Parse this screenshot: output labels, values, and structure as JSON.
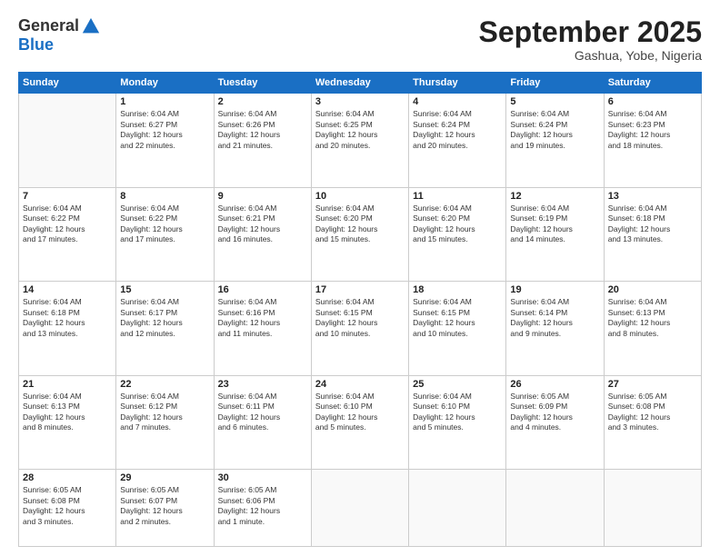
{
  "header": {
    "logo_general": "General",
    "logo_blue": "Blue",
    "month": "September 2025",
    "location": "Gashua, Yobe, Nigeria"
  },
  "days_of_week": [
    "Sunday",
    "Monday",
    "Tuesday",
    "Wednesday",
    "Thursday",
    "Friday",
    "Saturday"
  ],
  "weeks": [
    [
      {
        "day": "",
        "info": ""
      },
      {
        "day": "1",
        "info": "Sunrise: 6:04 AM\nSunset: 6:27 PM\nDaylight: 12 hours\nand 22 minutes."
      },
      {
        "day": "2",
        "info": "Sunrise: 6:04 AM\nSunset: 6:26 PM\nDaylight: 12 hours\nand 21 minutes."
      },
      {
        "day": "3",
        "info": "Sunrise: 6:04 AM\nSunset: 6:25 PM\nDaylight: 12 hours\nand 20 minutes."
      },
      {
        "day": "4",
        "info": "Sunrise: 6:04 AM\nSunset: 6:24 PM\nDaylight: 12 hours\nand 20 minutes."
      },
      {
        "day": "5",
        "info": "Sunrise: 6:04 AM\nSunset: 6:24 PM\nDaylight: 12 hours\nand 19 minutes."
      },
      {
        "day": "6",
        "info": "Sunrise: 6:04 AM\nSunset: 6:23 PM\nDaylight: 12 hours\nand 18 minutes."
      }
    ],
    [
      {
        "day": "7",
        "info": "Sunrise: 6:04 AM\nSunset: 6:22 PM\nDaylight: 12 hours\nand 17 minutes."
      },
      {
        "day": "8",
        "info": "Sunrise: 6:04 AM\nSunset: 6:22 PM\nDaylight: 12 hours\nand 17 minutes."
      },
      {
        "day": "9",
        "info": "Sunrise: 6:04 AM\nSunset: 6:21 PM\nDaylight: 12 hours\nand 16 minutes."
      },
      {
        "day": "10",
        "info": "Sunrise: 6:04 AM\nSunset: 6:20 PM\nDaylight: 12 hours\nand 15 minutes."
      },
      {
        "day": "11",
        "info": "Sunrise: 6:04 AM\nSunset: 6:20 PM\nDaylight: 12 hours\nand 15 minutes."
      },
      {
        "day": "12",
        "info": "Sunrise: 6:04 AM\nSunset: 6:19 PM\nDaylight: 12 hours\nand 14 minutes."
      },
      {
        "day": "13",
        "info": "Sunrise: 6:04 AM\nSunset: 6:18 PM\nDaylight: 12 hours\nand 13 minutes."
      }
    ],
    [
      {
        "day": "14",
        "info": "Sunrise: 6:04 AM\nSunset: 6:18 PM\nDaylight: 12 hours\nand 13 minutes."
      },
      {
        "day": "15",
        "info": "Sunrise: 6:04 AM\nSunset: 6:17 PM\nDaylight: 12 hours\nand 12 minutes."
      },
      {
        "day": "16",
        "info": "Sunrise: 6:04 AM\nSunset: 6:16 PM\nDaylight: 12 hours\nand 11 minutes."
      },
      {
        "day": "17",
        "info": "Sunrise: 6:04 AM\nSunset: 6:15 PM\nDaylight: 12 hours\nand 10 minutes."
      },
      {
        "day": "18",
        "info": "Sunrise: 6:04 AM\nSunset: 6:15 PM\nDaylight: 12 hours\nand 10 minutes."
      },
      {
        "day": "19",
        "info": "Sunrise: 6:04 AM\nSunset: 6:14 PM\nDaylight: 12 hours\nand 9 minutes."
      },
      {
        "day": "20",
        "info": "Sunrise: 6:04 AM\nSunset: 6:13 PM\nDaylight: 12 hours\nand 8 minutes."
      }
    ],
    [
      {
        "day": "21",
        "info": "Sunrise: 6:04 AM\nSunset: 6:13 PM\nDaylight: 12 hours\nand 8 minutes."
      },
      {
        "day": "22",
        "info": "Sunrise: 6:04 AM\nSunset: 6:12 PM\nDaylight: 12 hours\nand 7 minutes."
      },
      {
        "day": "23",
        "info": "Sunrise: 6:04 AM\nSunset: 6:11 PM\nDaylight: 12 hours\nand 6 minutes."
      },
      {
        "day": "24",
        "info": "Sunrise: 6:04 AM\nSunset: 6:10 PM\nDaylight: 12 hours\nand 5 minutes."
      },
      {
        "day": "25",
        "info": "Sunrise: 6:04 AM\nSunset: 6:10 PM\nDaylight: 12 hours\nand 5 minutes."
      },
      {
        "day": "26",
        "info": "Sunrise: 6:05 AM\nSunset: 6:09 PM\nDaylight: 12 hours\nand 4 minutes."
      },
      {
        "day": "27",
        "info": "Sunrise: 6:05 AM\nSunset: 6:08 PM\nDaylight: 12 hours\nand 3 minutes."
      }
    ],
    [
      {
        "day": "28",
        "info": "Sunrise: 6:05 AM\nSunset: 6:08 PM\nDaylight: 12 hours\nand 3 minutes."
      },
      {
        "day": "29",
        "info": "Sunrise: 6:05 AM\nSunset: 6:07 PM\nDaylight: 12 hours\nand 2 minutes."
      },
      {
        "day": "30",
        "info": "Sunrise: 6:05 AM\nSunset: 6:06 PM\nDaylight: 12 hours\nand 1 minute."
      },
      {
        "day": "",
        "info": ""
      },
      {
        "day": "",
        "info": ""
      },
      {
        "day": "",
        "info": ""
      },
      {
        "day": "",
        "info": ""
      }
    ]
  ]
}
